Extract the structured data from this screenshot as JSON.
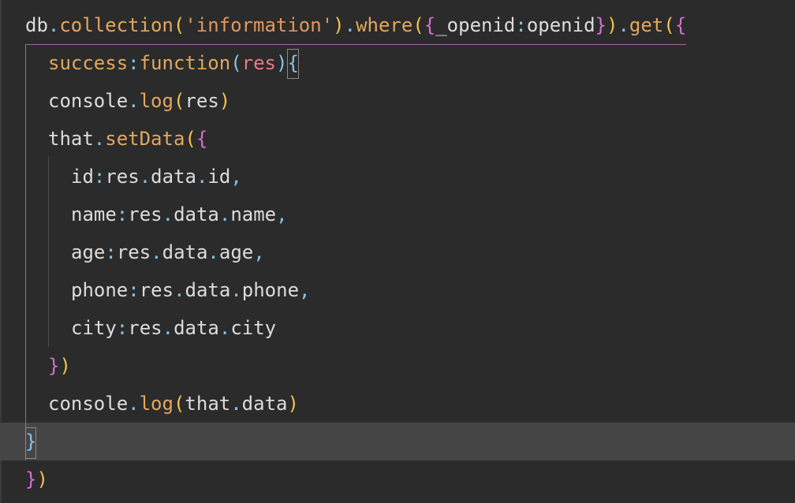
{
  "colors": {
    "background": "#2b2b2b",
    "current_line": "#454545",
    "plain": "#dcdcdc",
    "function": "#e3a75e",
    "string": "#e29660",
    "punctuation": "#86c3e8",
    "bracket_level1": "#f3c34d",
    "bracket_level2": "#d46fd3",
    "parameter": "#e47b84"
  },
  "code": {
    "line1": {
      "t1": "db",
      "t2": ".",
      "t3": "collection",
      "t4": "(",
      "t5": "'information'",
      "t6": ")",
      "t7": ".",
      "t8": "where",
      "t9": "(",
      "t10": "{",
      "t11": "_openid",
      "t12": ":",
      "t13": "openid",
      "t14": "}",
      "t15": ")",
      "t16": ".",
      "t17": "get",
      "t18": "(",
      "t19": "{"
    },
    "line2": {
      "t1": "success",
      "t2": ":",
      "t3": "function",
      "t4": "(",
      "t5": "res",
      "t6": ")",
      "t7": "{"
    },
    "line3": {
      "t1": "console",
      "t2": ".",
      "t3": "log",
      "t4": "(",
      "t5": "res",
      "t6": ")"
    },
    "line4": {
      "t1": "that",
      "t2": ".",
      "t3": "setData",
      "t4": "(",
      "t5": "{"
    },
    "line5": {
      "t1": "id",
      "t2": ":",
      "t3": "res",
      "t4": ".",
      "t5": "data",
      "t6": ".",
      "t7": "id",
      "t8": ","
    },
    "line6": {
      "t1": "name",
      "t2": ":",
      "t3": "res",
      "t4": ".",
      "t5": "data",
      "t6": ".",
      "t7": "name",
      "t8": ","
    },
    "line7": {
      "t1": "age",
      "t2": ":",
      "t3": "res",
      "t4": ".",
      "t5": "data",
      "t6": ".",
      "t7": "age",
      "t8": ","
    },
    "line8": {
      "t1": "phone",
      "t2": ":",
      "t3": "res",
      "t4": ".",
      "t5": "data",
      "t6": ".",
      "t7": "phone",
      "t8": ","
    },
    "line9": {
      "t1": "city",
      "t2": ":",
      "t3": "res",
      "t4": ".",
      "t5": "data",
      "t6": ".",
      "t7": "city"
    },
    "line10": {
      "t1": "}",
      "t2": ")"
    },
    "line11": {
      "t1": "console",
      "t2": ".",
      "t3": "log",
      "t4": "(",
      "t5": "that",
      "t6": ".",
      "t7": "data",
      "t8": ")"
    },
    "line12": {
      "t1": "}"
    },
    "line13": {
      "t1": "}",
      "t2": ")"
    }
  }
}
